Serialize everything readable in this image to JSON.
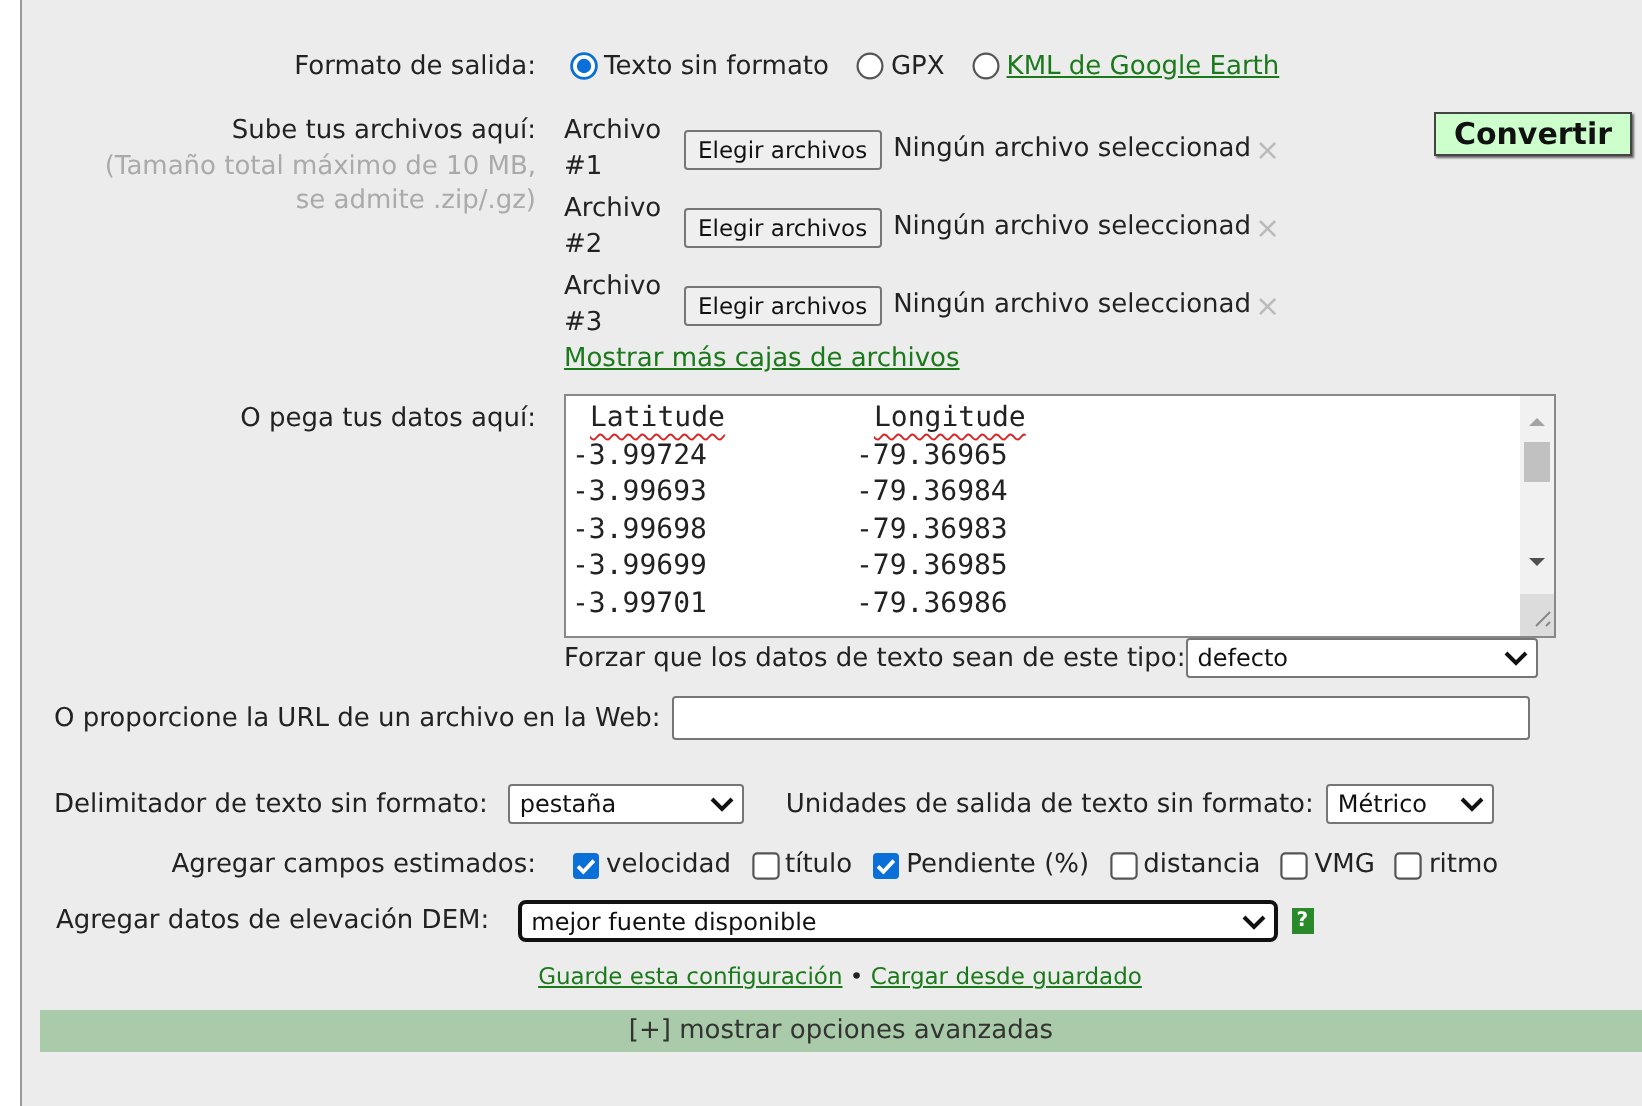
{
  "output_format": {
    "label": "Formato de salida:",
    "options": [
      {
        "label": "Texto sin formato",
        "selected": true,
        "kind": "plain"
      },
      {
        "label": "GPX",
        "selected": false,
        "kind": "plain"
      },
      {
        "label": "KML de Google Earth",
        "selected": false,
        "kind": "link"
      }
    ]
  },
  "upload": {
    "label": "Sube tus archivos aquí:",
    "note": "(Tamaño total máximo de 10 MB, se admite .zip/.gz)",
    "files": [
      {
        "label": "Archivo #1",
        "button": "Elegir archivos",
        "status": "Ningún archivo seleccionad",
        "clear": "×"
      },
      {
        "label": "Archivo #2",
        "button": "Elegir archivos",
        "status": "Ningún archivo seleccionad",
        "clear": "×"
      },
      {
        "label": "Archivo #3",
        "button": "Elegir archivos",
        "status": "Ningún archivo seleccionad",
        "clear": "×"
      }
    ],
    "more_link": "Mostrar más cajas de archivos"
  },
  "convert_button": "Convertir",
  "paste": {
    "label": "O pega tus datos aquí:",
    "header": [
      {
        "text": "Latitude",
        "spell_flagged": true
      },
      {
        "text": "Longitude",
        "spell_flagged": true
      }
    ],
    "rows": [
      [
        "-3.99724",
        "-79.36965"
      ],
      [
        "-3.99693",
        "-79.36984"
      ],
      [
        "-3.99698",
        "-79.36983"
      ],
      [
        "-3.99699",
        "-79.36985"
      ],
      [
        "-3.99701",
        "-79.36986"
      ]
    ]
  },
  "force_type": {
    "label": "Forzar que los datos de texto sean de este tipo:",
    "value": "defecto"
  },
  "url": {
    "label": "O proporcione la URL de un archivo en la Web:"
  },
  "delimiter": {
    "label": "Delimitador de texto sin formato:",
    "value": "pestaña"
  },
  "units": {
    "label": "Unidades de salida de texto sin formato:",
    "value": "Métrico"
  },
  "estimated": {
    "label": "Agregar campos estimados:",
    "options": [
      {
        "label": "velocidad",
        "checked": true
      },
      {
        "label": "título",
        "checked": false
      },
      {
        "label": "Pendiente (%)",
        "checked": true
      },
      {
        "label": "distancia",
        "checked": false
      },
      {
        "label": "VMG",
        "checked": false
      },
      {
        "label": "ritmo",
        "checked": false
      }
    ]
  },
  "dem": {
    "label": "Agregar datos de elevación DEM:",
    "value": "mejor fuente disponible",
    "focused": true,
    "help": "?"
  },
  "links": [
    {
      "label": "Guarde esta configuración"
    },
    {
      "label": "Cargar desde guardado"
    }
  ],
  "link_separator": "•",
  "advanced": "[+] mostrar opciones avanzadas"
}
